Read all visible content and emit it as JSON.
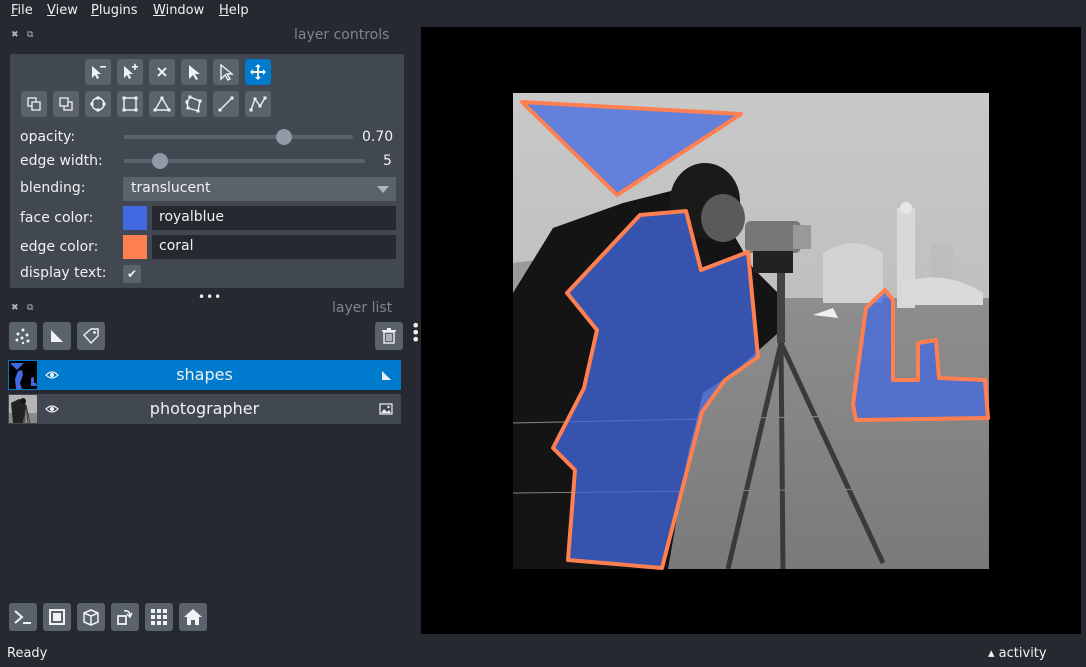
{
  "menu": {
    "file_accel": "F",
    "file_rest": "ile",
    "view_accel": "V",
    "view_rest": "iew",
    "plugins_accel": "P",
    "plugins_rest": "lugins",
    "window_accel": "W",
    "window_rest": "indow",
    "help_accel": "H",
    "help_rest": "elp"
  },
  "layer_controls": {
    "title": "layer controls",
    "opacity_label": "opacity:",
    "opacity_value": "0.70",
    "opacity_fraction": 0.7,
    "edge_width_label": "edge width:",
    "edge_width_value": "5",
    "edge_width_fraction": 0.15,
    "blending_label": "blending:",
    "blending_value": "translucent",
    "face_color_label": "face color:",
    "face_color_value": "royalblue",
    "face_color_hex": "#4169e1",
    "edge_color_label": "edge color:",
    "edge_color_value": "coral",
    "edge_color_hex": "#ff7f50",
    "display_text_label": "display text:",
    "display_text_checked": true,
    "active_tool": "move-tool"
  },
  "layer_list": {
    "title": "layer list",
    "layers": [
      {
        "name": "shapes",
        "selected": true,
        "visible": true,
        "type_icon": "shapes-icon"
      },
      {
        "name": "photographer",
        "selected": false,
        "visible": true,
        "type_icon": "image-icon"
      }
    ]
  },
  "status": {
    "text": "Ready",
    "activity": "activity"
  },
  "colors": {
    "accent": "#007acc",
    "background": "#262930",
    "panel": "#414851",
    "button": "#5a626c"
  }
}
